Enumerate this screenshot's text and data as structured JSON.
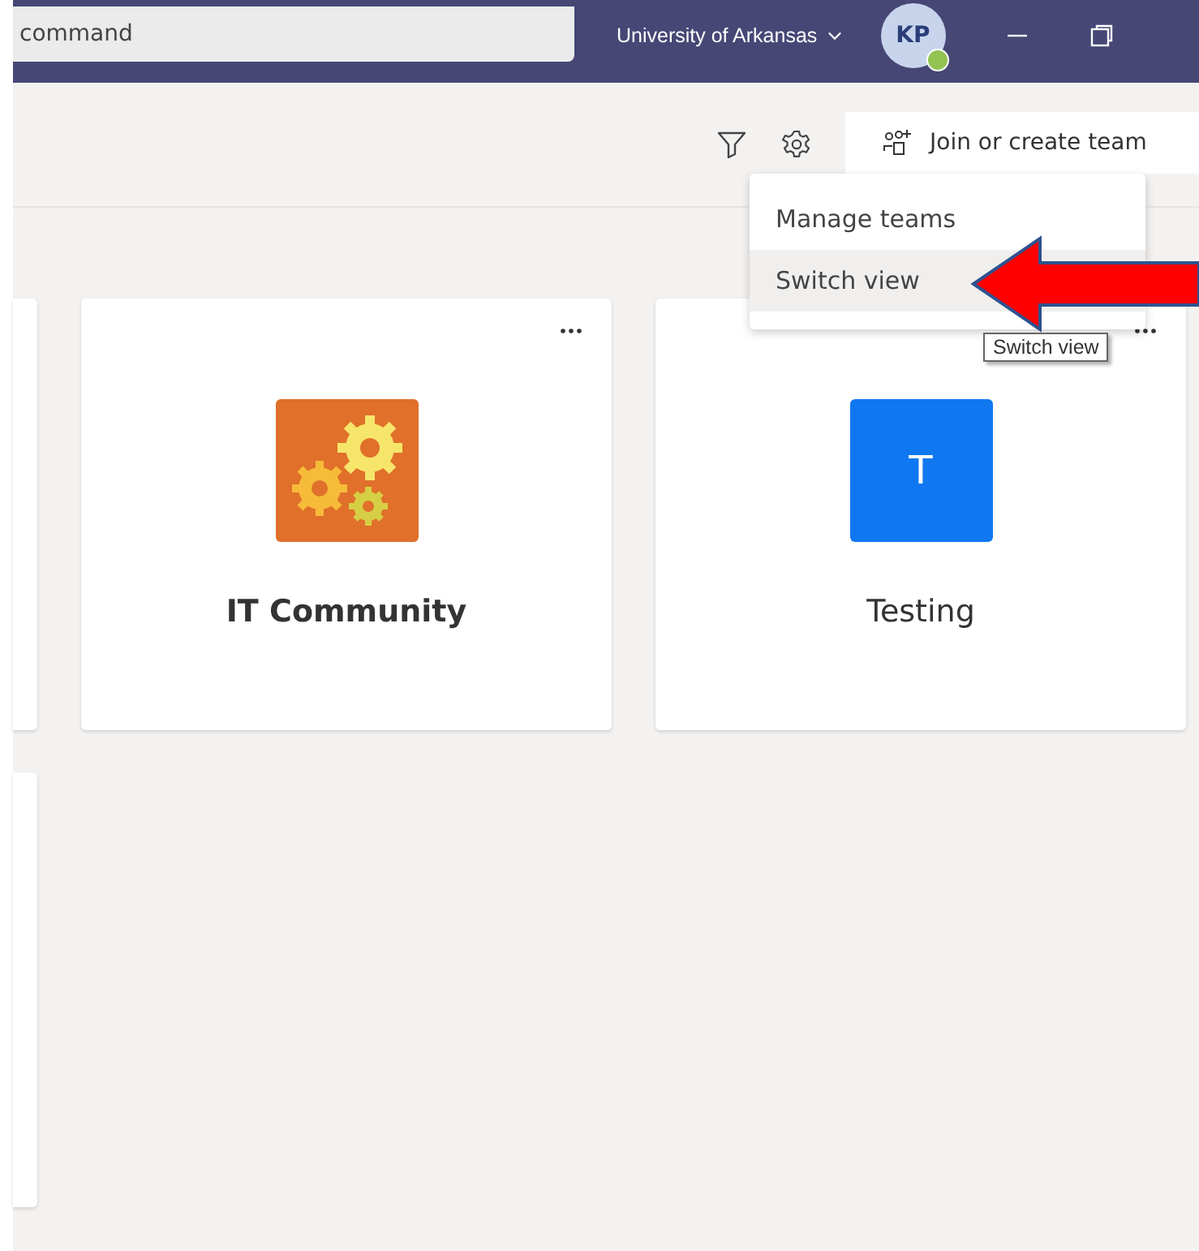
{
  "title_bar": {
    "search": {
      "placeholder": "command"
    },
    "organization": "University of Arkansas",
    "avatar": {
      "initials": "KP",
      "available": true
    }
  },
  "toolbar": {
    "join_button": "Join or create team"
  },
  "settings_menu": {
    "items": [
      {
        "label": "Manage teams",
        "selected": false
      },
      {
        "label": "Switch view",
        "selected": true
      }
    ]
  },
  "tooltip": "Switch view",
  "teams": [
    {
      "kind": "gears",
      "name": "IT Community",
      "unread": true
    },
    {
      "kind": "letter",
      "letter": "T",
      "name": "Testing",
      "unread": false
    }
  ]
}
